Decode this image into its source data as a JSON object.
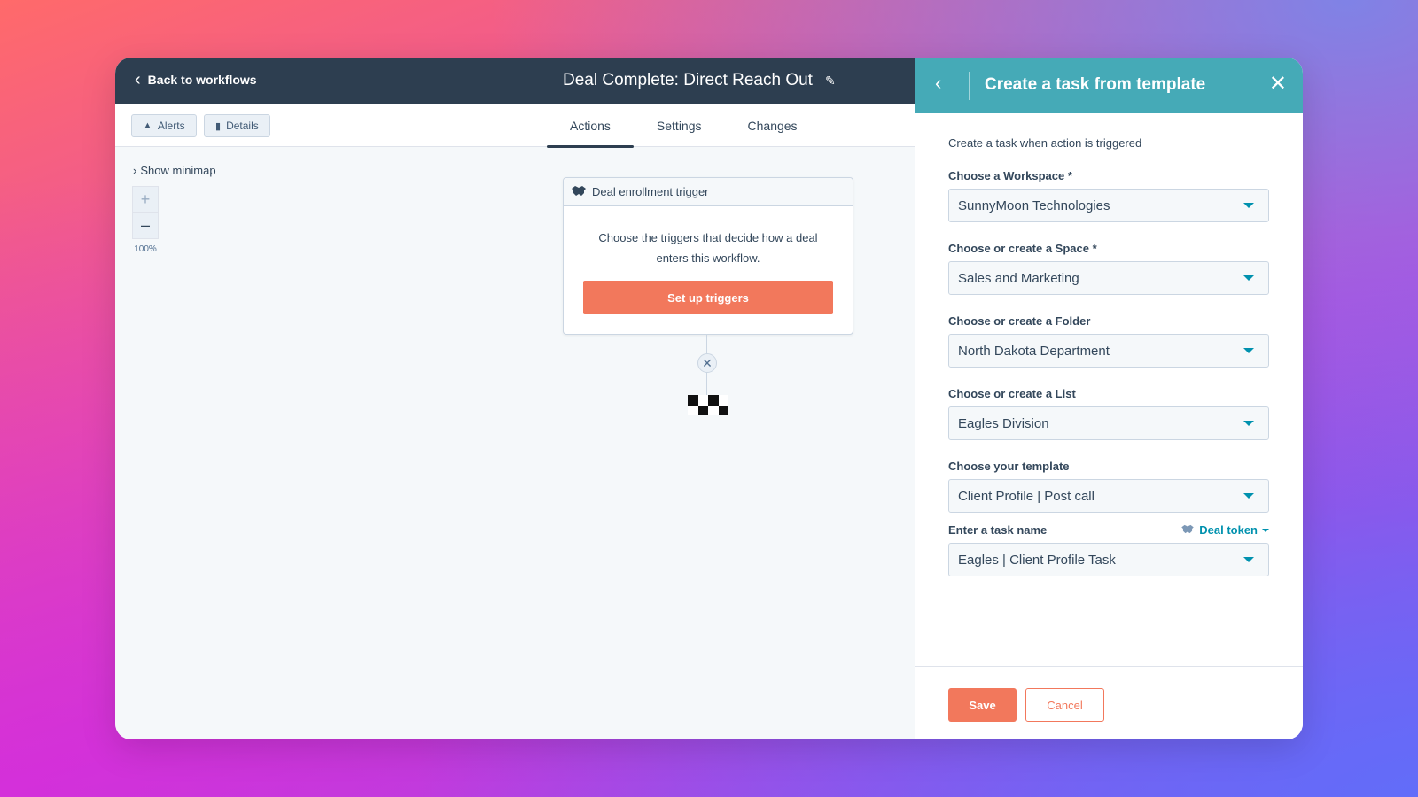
{
  "workflow": {
    "back_label": "Back to workflows",
    "title": "Deal Complete: Direct Reach Out",
    "alerts_label": "Alerts",
    "details_label": "Details",
    "tabs": [
      {
        "label": "Actions",
        "active": true
      },
      {
        "label": "Settings",
        "active": false
      },
      {
        "label": "Changes",
        "active": false
      }
    ],
    "minimap_label": "Show minimap",
    "zoom_plus": "+",
    "zoom_minus": "–",
    "zoom_level": "100%",
    "trigger_card": {
      "title": "Deal enrollment trigger",
      "description": "Choose the triggers that decide how a deal enters this workflow.",
      "button_label": "Set up triggers"
    },
    "delete_glyph": "✕"
  },
  "panel": {
    "title": "Create a task from template",
    "intro": "Create a task when action is triggered",
    "fields": [
      {
        "label": "Choose a Workspace *",
        "value": "SunnyMoon Technologies"
      },
      {
        "label": "Choose or create a Space *",
        "value": "Sales and Marketing"
      },
      {
        "label": "Choose or create a Folder",
        "value": "North Dakota Department"
      },
      {
        "label": "Choose or create a List",
        "value": "Eagles Division"
      },
      {
        "label": "Choose your template",
        "value": "Client Profile | Post call"
      },
      {
        "label": "Enter a task name",
        "value": "Eagles | Client Profile Task"
      }
    ],
    "token_label": "Deal token",
    "save_label": "Save",
    "cancel_label": "Cancel"
  },
  "colors": {
    "header_dark": "#2d3e50",
    "panel_header": "#45aab7",
    "accent_orange": "#f2785c",
    "link_teal": "#0091ae"
  },
  "icons": [
    "chevron-left-icon",
    "pencil-icon",
    "warning-icon",
    "bar-chart-icon",
    "chevron-right-icon",
    "handshake-icon",
    "close-icon",
    "caret-down-icon",
    "finish-flag-icon"
  ]
}
